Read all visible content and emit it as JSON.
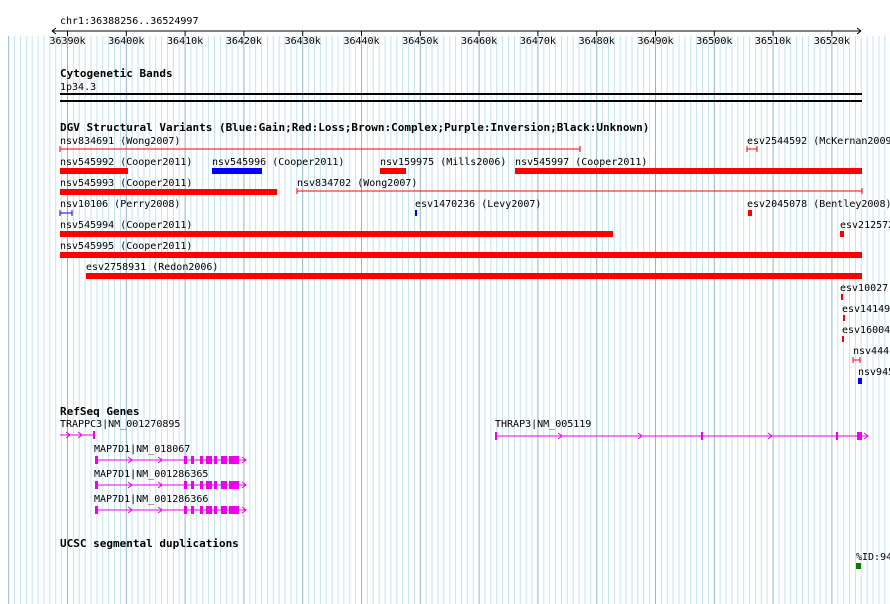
{
  "position": {
    "label": "chr1:36388256..36524997",
    "ticks": [
      "36390k",
      "36400k",
      "36410k",
      "36420k",
      "36430k",
      "36440k",
      "36450k",
      "36460k",
      "36470k",
      "36480k",
      "36490k",
      "36500k",
      "36510k",
      "36520k"
    ]
  },
  "tracks": {
    "cytoband": {
      "title": "Cytogenetic Bands",
      "band": "1p34.3"
    },
    "dgv": {
      "title": "DGV Structural Variants (Blue:Gain;Red:Loss;Brown:Complex;Purple:Inversion;Black:Unknown)",
      "features": [
        {
          "name": "nsv834691 (Wong2007)",
          "color": "#ff0000"
        },
        {
          "name": "esv2544592 (McKernan2009",
          "color": "#ff0000"
        },
        {
          "name": "nsv545992 (Cooper2011)",
          "color": "#ff0000"
        },
        {
          "name": "nsv545996 (Cooper2011)",
          "color": "#0000ff"
        },
        {
          "name": "nsv159975 (Mills2006)",
          "color": "#ff0000"
        },
        {
          "name": "nsv545997 (Cooper2011)",
          "color": "#ff0000"
        },
        {
          "name": "nsv545993 (Cooper2011)",
          "color": "#ff0000"
        },
        {
          "name": "nsv834702 (Wong2007)",
          "color": "#ff0000"
        },
        {
          "name": "nsv10106 (Perry2008)",
          "color": "#0000ff"
        },
        {
          "name": "esv1470236 (Levy2007)",
          "color": "#0000ff"
        },
        {
          "name": "esv2045078 (Bentley2008)",
          "color": "#ff0000"
        },
        {
          "name": "nsv545994 (Cooper2011)",
          "color": "#ff0000"
        },
        {
          "name": "esv212572",
          "color": "#ff0000"
        },
        {
          "name": "nsv545995 (Cooper2011)",
          "color": "#ff0000"
        },
        {
          "name": "esv2758931 (Redon2006)",
          "color": "#ff0000"
        },
        {
          "name": "esv10027",
          "color": "#ff0000"
        },
        {
          "name": "esv14149",
          "color": "#ff0000"
        },
        {
          "name": "esv16004",
          "color": "#ff0000"
        },
        {
          "name": "nsv444",
          "color": "#ff0000"
        },
        {
          "name": "nsv945",
          "color": "#0000ff"
        }
      ]
    },
    "refseq": {
      "title": "RefSeq Genes",
      "color": "#ee00ee",
      "genes": [
        {
          "name": "TRAPPC3|NM_001270895"
        },
        {
          "name": "THRAP3|NM_005119"
        },
        {
          "name": "MAP7D1|NM_018067"
        },
        {
          "name": "MAP7D1|NM_001286365"
        },
        {
          "name": "MAP7D1|NM_001286366"
        }
      ]
    },
    "segdup": {
      "title": "UCSC segmental duplications",
      "label": "%ID:94",
      "color": "#008000"
    }
  },
  "colors": {
    "grid_major": "#8fb8cc",
    "grid_minor": "#c4e4f0",
    "loss": "#ff0000",
    "gain": "#0000ff",
    "gene": "#ee00ee"
  }
}
